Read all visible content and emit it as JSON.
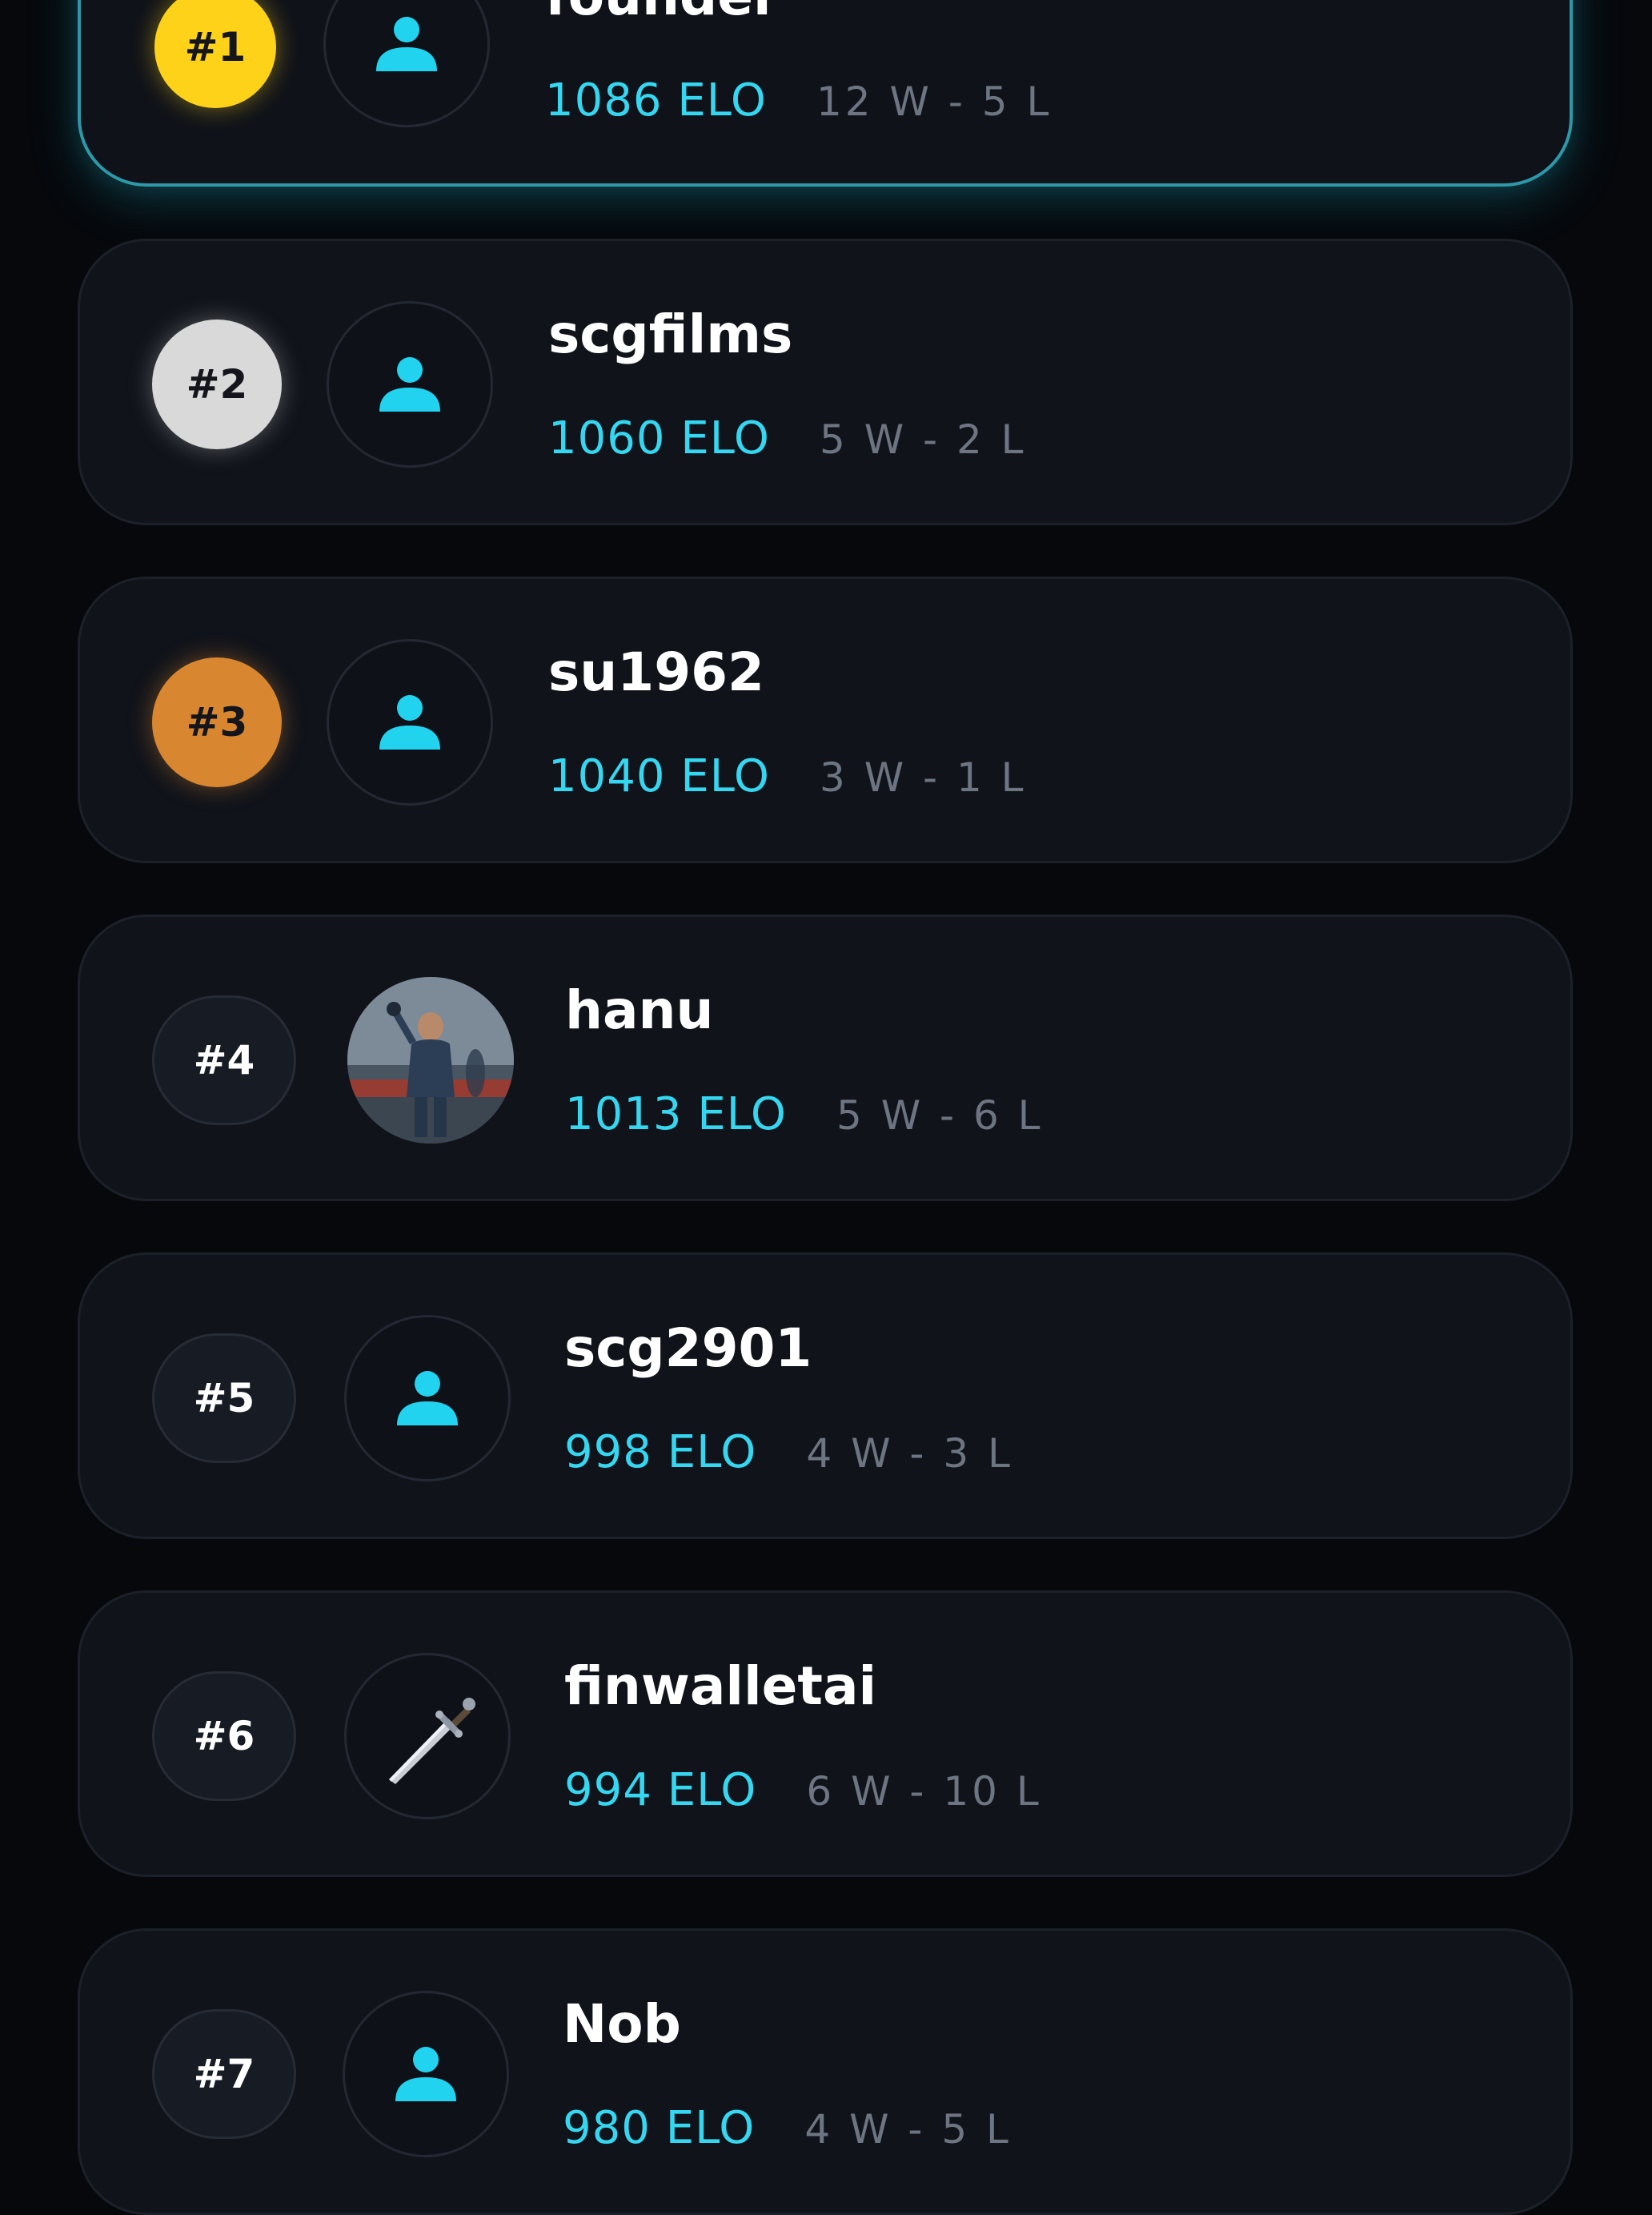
{
  "leaderboard": {
    "players": [
      {
        "rank": "#1",
        "name": "founder",
        "elo": "1086 ELO",
        "record": "12 W - 5 L",
        "avatar": "person-icon",
        "badge_color": "#ffd21a",
        "highlighted": true
      },
      {
        "rank": "#2",
        "name": "scgfilms",
        "elo": "1060 ELO",
        "record": "5 W - 2 L",
        "avatar": "person-icon",
        "badge_color": "#d9d9d9"
      },
      {
        "rank": "#3",
        "name": "su1962",
        "elo": "1040 ELO",
        "record": "3 W - 1 L",
        "avatar": "person-icon",
        "badge_color": "#d98630"
      },
      {
        "rank": "#4",
        "name": "hanu",
        "elo": "1013 ELO",
        "record": "5 W - 6 L",
        "avatar": "profile-photo"
      },
      {
        "rank": "#5",
        "name": "scg2901",
        "elo": "998 ELO",
        "record": "4 W - 3 L",
        "avatar": "person-icon"
      },
      {
        "rank": "#6",
        "name": "finwalletai",
        "elo": "994 ELO",
        "record": "6 W - 10 L",
        "avatar": "dagger-icon"
      },
      {
        "rank": "#7",
        "name": "Nob",
        "elo": "980 ELO",
        "record": "4 W - 5 L",
        "avatar": "person-icon"
      }
    ]
  },
  "colors": {
    "background": "#06080c",
    "card": "#10131a",
    "accent": "#35d6f0",
    "highlight_border": "#2e98a8",
    "record_text": "#6d7583"
  }
}
